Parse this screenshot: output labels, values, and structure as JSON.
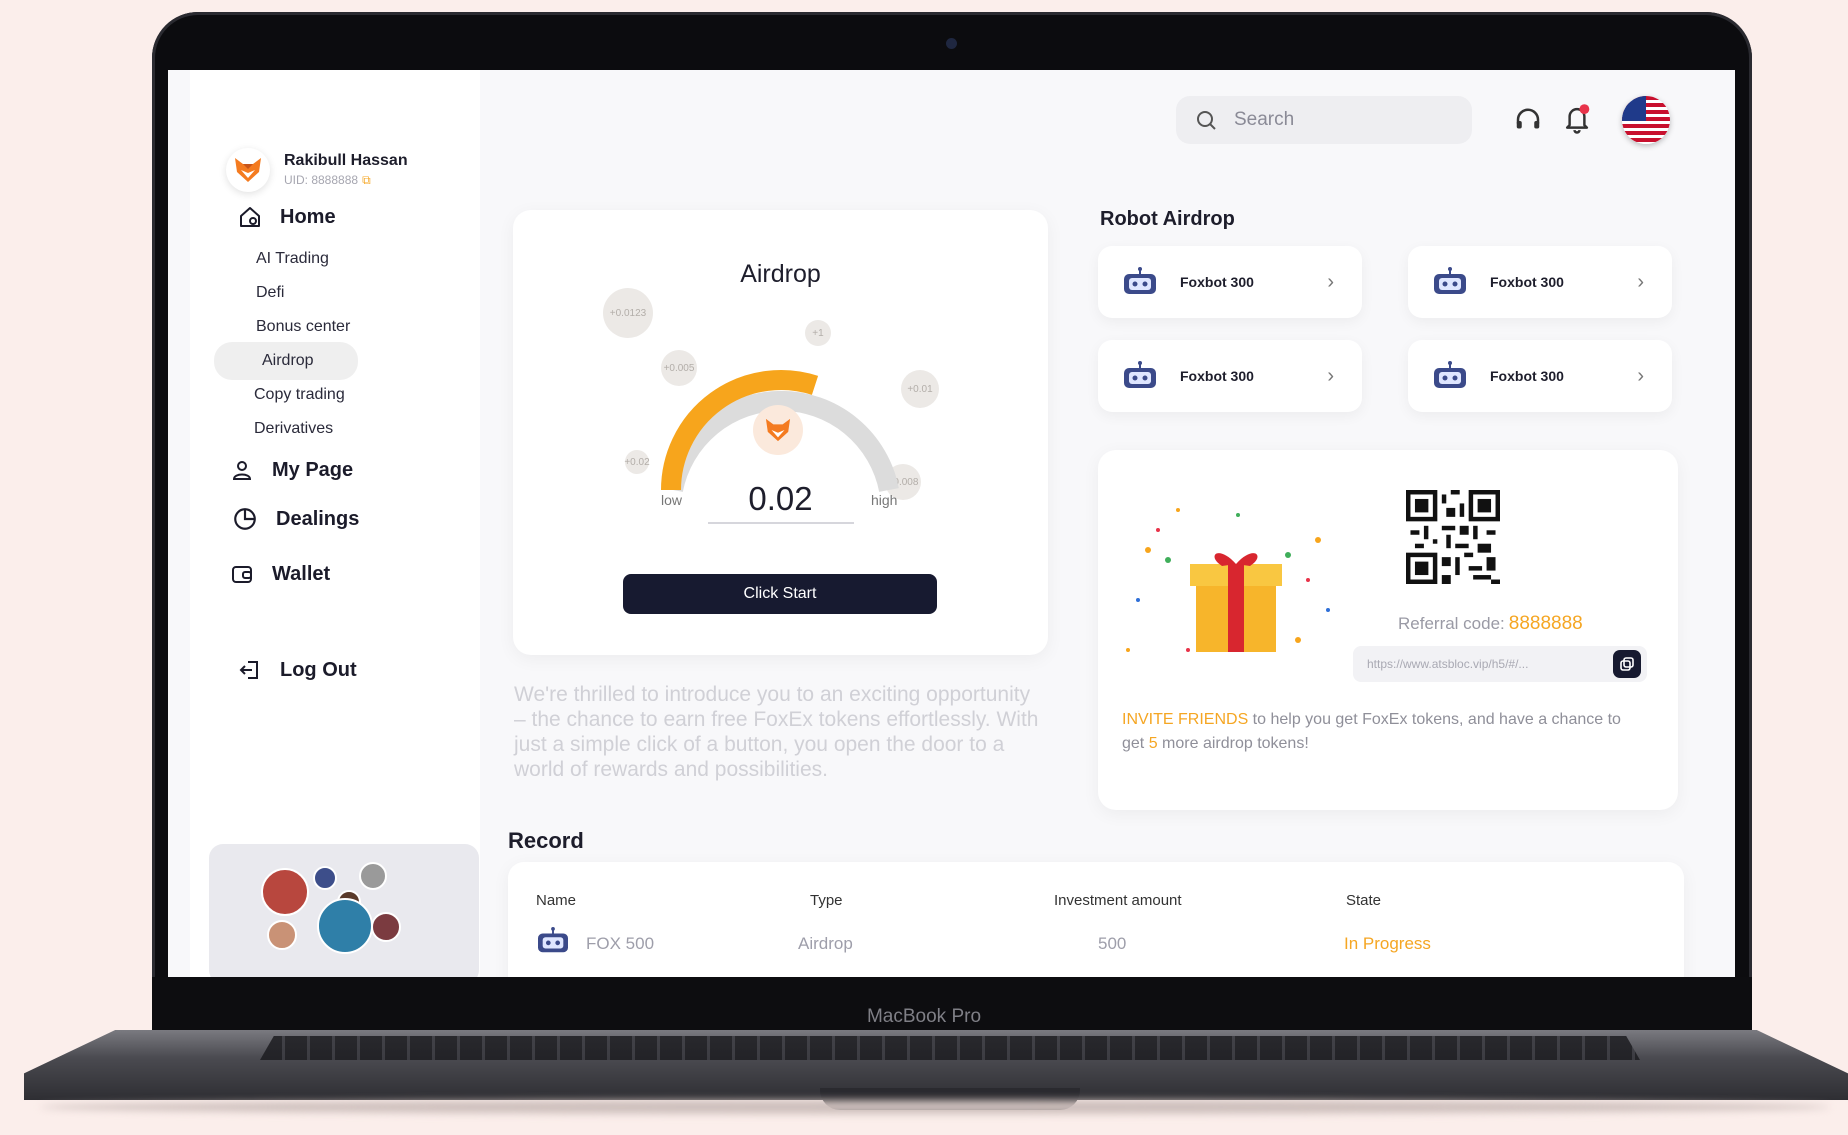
{
  "device": {
    "label": "MacBook Pro"
  },
  "user": {
    "name": "Rakibull Hassan",
    "uid": "UID: 8888888"
  },
  "sidebar": {
    "main": [
      {
        "label": "Home",
        "icon": "home-icon"
      },
      {
        "label": "My Page",
        "icon": "user-icon"
      },
      {
        "label": "Dealings",
        "icon": "pie-chart-icon"
      },
      {
        "label": "Wallet",
        "icon": "wallet-icon"
      },
      {
        "label": "Log Out",
        "icon": "logout-icon"
      }
    ],
    "sub": [
      "AI Trading",
      "Defi",
      "Bonus center",
      "Airdrop",
      "Copy trading",
      "Derivatives"
    ],
    "active": "Airdrop"
  },
  "header": {
    "search_placeholder": "Search",
    "notification_dot_color": "#e8334a"
  },
  "airdrop": {
    "title": "Airdrop",
    "value": "0.02",
    "low_label": "low",
    "high_label": "high",
    "level": 0.6,
    "button": "Click Start",
    "bubbles": [
      "+0.0123",
      "+1",
      "+0.005",
      "+0.01",
      "+0.02",
      "+0.008"
    ]
  },
  "intro_text": "We're thrilled to introduce you to an exciting opportunity – the chance to earn free FoxEx tokens effortlessly. With just a simple click of a button, you open the door to a world of rewards and possibilities.",
  "robot_airdrop": {
    "title": "Robot Airdrop",
    "items": [
      "Foxbot 300",
      "Foxbot 300",
      "Foxbot 300",
      "Foxbot 300"
    ]
  },
  "invite": {
    "referral_label": "Referral code:",
    "referral_code": "8888888",
    "link": "https://www.atsbloc.vip/h5/#/...",
    "text_highlight": "INVITE FRIENDS",
    "text_part1": " to help you get FoxEx tokens, and have a chance to get ",
    "text_number": "5",
    "text_part2": " more airdrop tokens!"
  },
  "record": {
    "title": "Record",
    "columns": [
      "Name",
      "Type",
      "Investment amount",
      "State"
    ],
    "rows": [
      {
        "name": "FOX 500",
        "type": "Airdrop",
        "amount": "500",
        "state": "In Progress"
      }
    ]
  },
  "colors": {
    "accent": "#f5a623",
    "dark": "#171a30",
    "page_bg": "#fbeeeb"
  }
}
